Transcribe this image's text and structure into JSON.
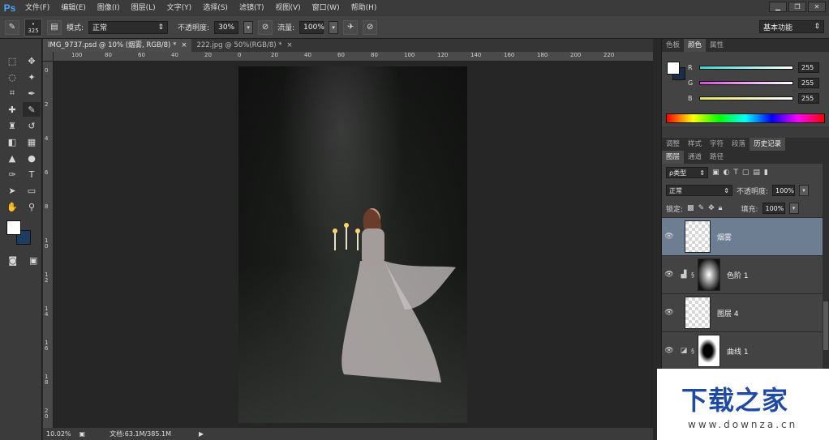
{
  "app": {
    "logo": "Ps"
  },
  "menu": [
    "文件(F)",
    "编辑(E)",
    "图像(I)",
    "图层(L)",
    "文字(Y)",
    "选择(S)",
    "滤镜(T)",
    "视图(V)",
    "窗口(W)",
    "帮助(H)"
  ],
  "window_controls": {
    "minimize": "▁",
    "restore": "❐",
    "close": "✕"
  },
  "options": {
    "brush_size": "325",
    "mode_label": "模式:",
    "mode_value": "正常",
    "opacity_label": "不透明度:",
    "opacity_value": "30%",
    "flow_label": "流量:",
    "flow_value": "100%",
    "workspace": "基本功能"
  },
  "tabs": [
    {
      "title": "IMG_9737.psd @ 10% (烟雾, RGB/8) *",
      "close": "×"
    },
    {
      "title": "222.jpg @ 50%(RGB/8) *",
      "close": "×"
    }
  ],
  "ruler_h": [
    "100",
    "80",
    "60",
    "40",
    "20",
    "0",
    "20",
    "40",
    "60",
    "80",
    "100",
    "120",
    "140",
    "160",
    "180",
    "200",
    "220"
  ],
  "ruler_v": [
    "0",
    "2",
    "4",
    "6",
    "8",
    "10",
    "12",
    "14",
    "16",
    "18",
    "20"
  ],
  "status": {
    "zoom": "10.02%",
    "doc": "文档:63.1M/385.1M",
    "arrow": "▶"
  },
  "color_panel": {
    "tabs": [
      "色板",
      "颜色",
      "属性"
    ],
    "active_tab": "颜色",
    "sliders": [
      {
        "label": "R",
        "value": "255"
      },
      {
        "label": "G",
        "value": "255"
      },
      {
        "label": "B",
        "value": "255"
      }
    ],
    "colors": {
      "r": "#35d6d6",
      "g": "#d64cd6",
      "b": "#e6e65a"
    }
  },
  "mid_tabs": [
    "调整",
    "样式",
    "字符",
    "段落",
    "历史记录"
  ],
  "layers_panel": {
    "tabs": [
      "图层",
      "通道",
      "路径"
    ],
    "kind_filter": "ρ类型",
    "blend_mode": "正常",
    "opacity_label": "不透明度:",
    "opacity_value": "100%",
    "lock_label": "锁定:",
    "fill_label": "填充:",
    "fill_value": "100%",
    "layers": [
      {
        "name": "烟雾",
        "selected": true
      },
      {
        "name": "色阶 1",
        "selected": false
      },
      {
        "name": "图层 4",
        "selected": false
      },
      {
        "name": "曲线 1",
        "selected": false
      },
      {
        "name": "",
        "selected": false
      }
    ]
  },
  "watermark": {
    "title": "下载之家",
    "url": "www.downza.cn"
  }
}
